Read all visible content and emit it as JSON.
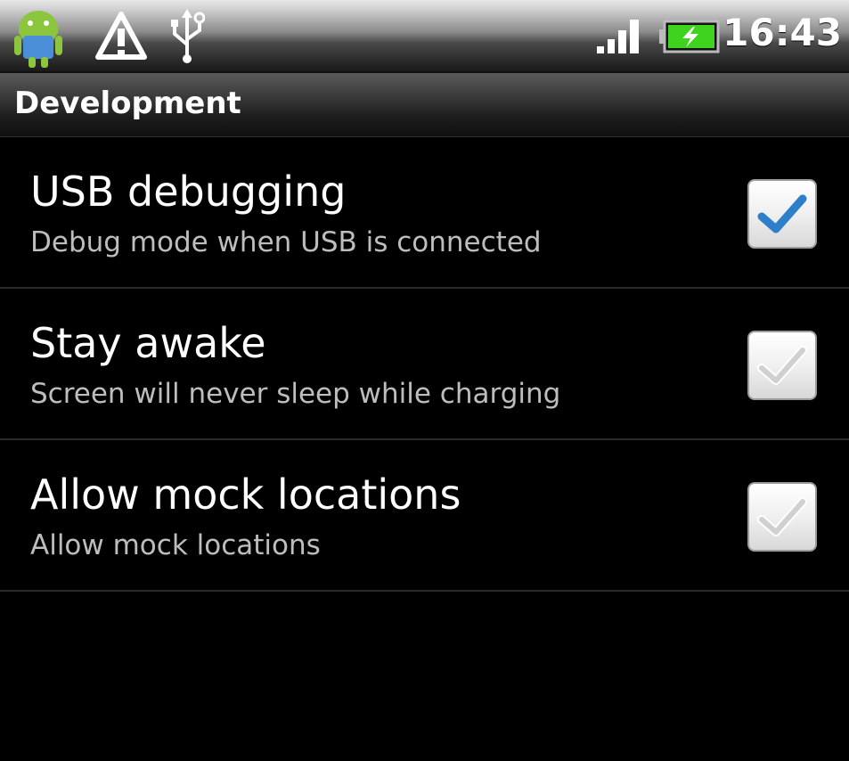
{
  "status_bar": {
    "time": "16:43",
    "icons": [
      "android-icon",
      "warning-icon",
      "usb-icon",
      "signal-icon",
      "battery-charging-icon"
    ],
    "colors": {
      "battery": "#3fd21f",
      "android": "#8cc63f",
      "warning": "#ffffff"
    }
  },
  "title": "Development",
  "preferences": [
    {
      "title": "USB debugging",
      "summary": "Debug mode when USB is connected",
      "checked": true
    },
    {
      "title": "Stay awake",
      "summary": "Screen will never sleep while charging",
      "checked": false
    },
    {
      "title": "Allow mock locations",
      "summary": "Allow mock locations",
      "checked": false
    }
  ],
  "colors": {
    "check_mark": "#2e7fc9",
    "background": "#000000",
    "summary_text": "#bdbdbd"
  }
}
